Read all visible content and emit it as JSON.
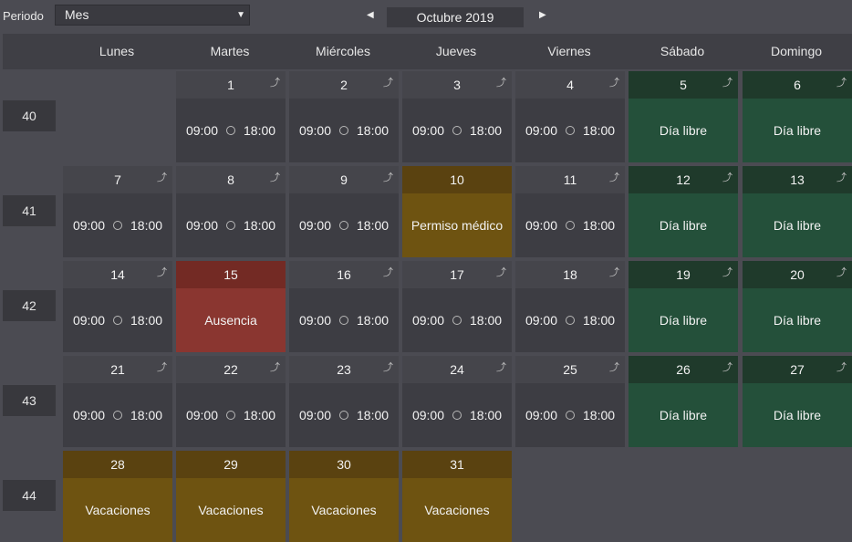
{
  "toolbar": {
    "period_label": "Periodo",
    "period_value": "Mes",
    "prev_icon": "◀",
    "next_icon": "▶",
    "caret_icon": "▼",
    "month_title": "Octubre 2019"
  },
  "weekdays": [
    "Lunes",
    "Martes",
    "Miércoles",
    "Jueves",
    "Viernes",
    "Sábado",
    "Domingo"
  ],
  "colors": {
    "work": "#3d3d43",
    "free": "#24503a",
    "medical": "#6e5311",
    "absence": "#8a3630",
    "vacation": "#6e5311"
  },
  "weeks": [
    {
      "number": "40",
      "days": [
        null,
        {
          "day": "1",
          "type": "work",
          "start": "09:00",
          "end": "18:00",
          "share": true
        },
        {
          "day": "2",
          "type": "work",
          "start": "09:00",
          "end": "18:00",
          "share": true
        },
        {
          "day": "3",
          "type": "work",
          "start": "09:00",
          "end": "18:00",
          "share": true
        },
        {
          "day": "4",
          "type": "work",
          "start": "09:00",
          "end": "18:00",
          "share": true
        },
        {
          "day": "5",
          "type": "free",
          "label": "Día libre",
          "share": true
        },
        {
          "day": "6",
          "type": "free",
          "label": "Día libre",
          "share": true
        }
      ]
    },
    {
      "number": "41",
      "days": [
        {
          "day": "7",
          "type": "work",
          "start": "09:00",
          "end": "18:00",
          "share": true
        },
        {
          "day": "8",
          "type": "work",
          "start": "09:00",
          "end": "18:00",
          "share": true
        },
        {
          "day": "9",
          "type": "work",
          "start": "09:00",
          "end": "18:00",
          "share": true
        },
        {
          "day": "10",
          "type": "medical",
          "label": "Permiso médico",
          "share": false
        },
        {
          "day": "11",
          "type": "work",
          "start": "09:00",
          "end": "18:00",
          "share": true
        },
        {
          "day": "12",
          "type": "free",
          "label": "Día libre",
          "share": true
        },
        {
          "day": "13",
          "type": "free",
          "label": "Día libre",
          "share": true
        }
      ]
    },
    {
      "number": "42",
      "days": [
        {
          "day": "14",
          "type": "work",
          "start": "09:00",
          "end": "18:00",
          "share": true
        },
        {
          "day": "15",
          "type": "absence",
          "label": "Ausencia",
          "share": false
        },
        {
          "day": "16",
          "type": "work",
          "start": "09:00",
          "end": "18:00",
          "share": true
        },
        {
          "day": "17",
          "type": "work",
          "start": "09:00",
          "end": "18:00",
          "share": true
        },
        {
          "day": "18",
          "type": "work",
          "start": "09:00",
          "end": "18:00",
          "share": true
        },
        {
          "day": "19",
          "type": "free",
          "label": "Día libre",
          "share": true
        },
        {
          "day": "20",
          "type": "free",
          "label": "Día libre",
          "share": true
        }
      ]
    },
    {
      "number": "43",
      "days": [
        {
          "day": "21",
          "type": "work",
          "start": "09:00",
          "end": "18:00",
          "share": true
        },
        {
          "day": "22",
          "type": "work",
          "start": "09:00",
          "end": "18:00",
          "share": true
        },
        {
          "day": "23",
          "type": "work",
          "start": "09:00",
          "end": "18:00",
          "share": true
        },
        {
          "day": "24",
          "type": "work",
          "start": "09:00",
          "end": "18:00",
          "share": true
        },
        {
          "day": "25",
          "type": "work",
          "start": "09:00",
          "end": "18:00",
          "share": true
        },
        {
          "day": "26",
          "type": "free",
          "label": "Día libre",
          "share": true
        },
        {
          "day": "27",
          "type": "free",
          "label": "Día libre",
          "share": true
        }
      ]
    },
    {
      "number": "44",
      "days": [
        {
          "day": "28",
          "type": "vacation",
          "label": "Vacaciones",
          "share": false
        },
        {
          "day": "29",
          "type": "vacation",
          "label": "Vacaciones",
          "share": false
        },
        {
          "day": "30",
          "type": "vacation",
          "label": "Vacaciones",
          "share": false
        },
        {
          "day": "31",
          "type": "vacation",
          "label": "Vacaciones",
          "share": false
        },
        null,
        null,
        null
      ]
    }
  ]
}
